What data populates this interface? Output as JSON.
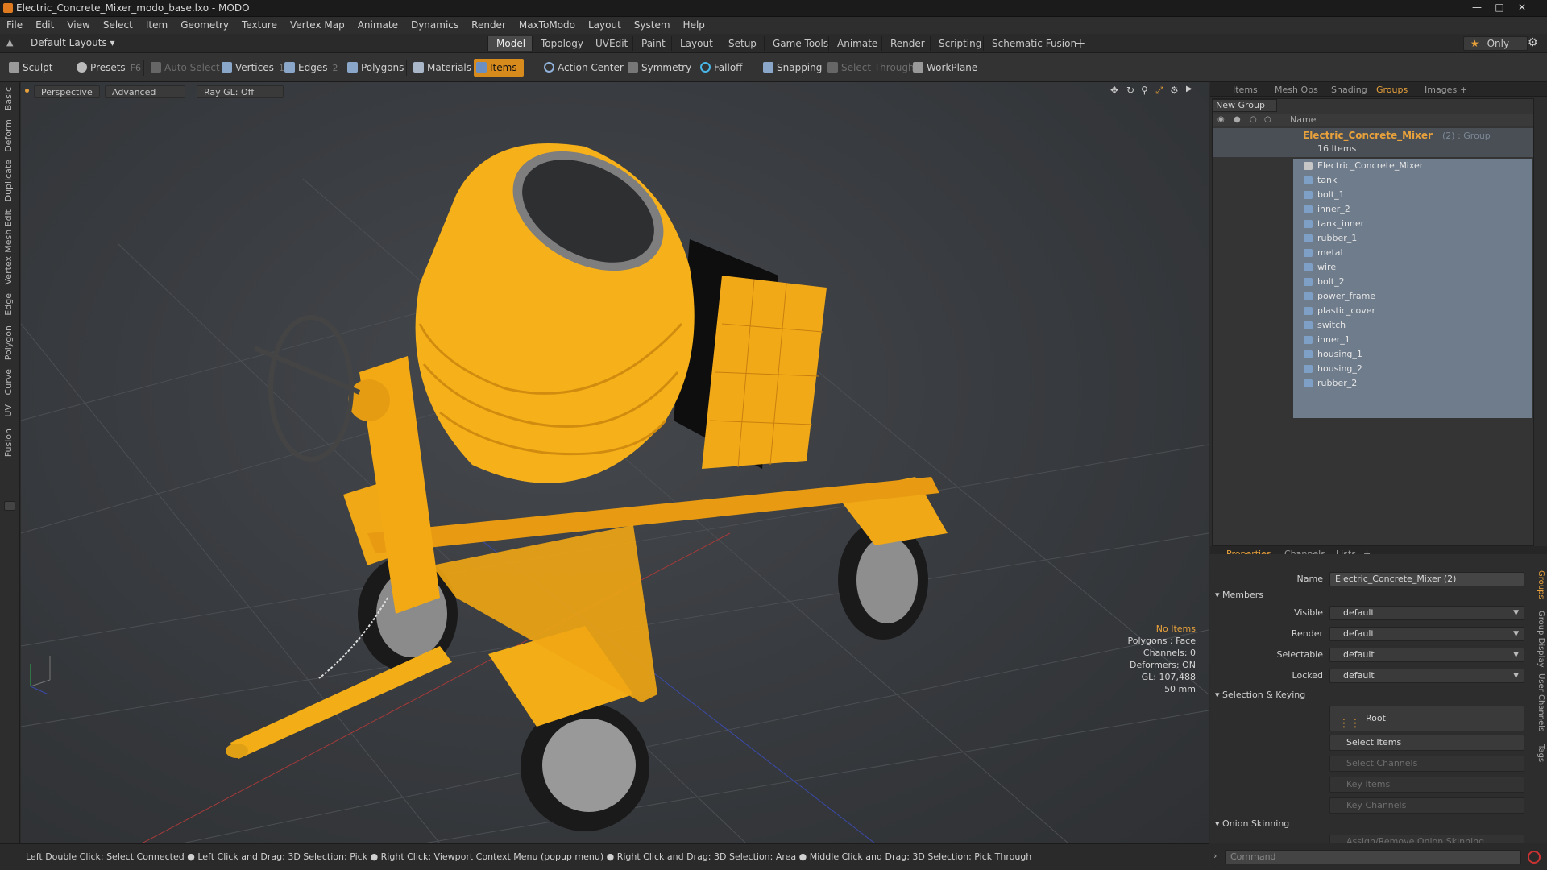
{
  "window": {
    "title": "Electric_Concrete_Mixer_modo_base.lxo - MODO"
  },
  "menu": [
    "File",
    "Edit",
    "View",
    "Select",
    "Item",
    "Geometry",
    "Texture",
    "Vertex Map",
    "Animate",
    "Dynamics",
    "Render",
    "MaxToModo",
    "Layout",
    "System",
    "Help"
  ],
  "layout": {
    "preset": "Default Layouts ▾",
    "tabs": [
      "Model",
      "Topology",
      "UVEdit",
      "Paint",
      "Layout",
      "Setup",
      "Game Tools",
      "Animate",
      "Render",
      "Scripting",
      "Schematic Fusion"
    ],
    "active_tab": "Model",
    "only_label": "Only"
  },
  "toolbar": {
    "sculpt": "Sculpt",
    "presets": "Presets",
    "presets_key": "F6",
    "auto_select": "Auto Select",
    "vertices": "Vertices",
    "vertices_count": "1",
    "edges": "Edges",
    "edges_count": "2",
    "polygons": "Polygons",
    "materials": "Materials",
    "items": "Items",
    "action_center": "Action Center",
    "symmetry": "Symmetry",
    "falloff": "Falloff",
    "snapping": "Snapping",
    "select_through": "Select Through",
    "workplane": "WorkPlane"
  },
  "lefttabs": [
    "Basic",
    "Deform",
    "Duplicate",
    "Mesh Edit",
    "Vertex",
    "Edge",
    "Polygon",
    "Curve",
    "UV",
    "Fusion"
  ],
  "viewport": {
    "perspective": "Perspective",
    "advanced": "Advanced",
    "raygl": "Ray GL: Off",
    "info": {
      "no_items": "No Items",
      "polygons": "Polygons : Face",
      "channels": "Channels: 0",
      "deformers": "Deformers: ON",
      "gl": "GL: 107,488",
      "scale": "50 mm"
    }
  },
  "groups_panel": {
    "tabs": [
      "Items",
      "Mesh Ops",
      "Shading",
      "Groups",
      "Images"
    ],
    "active_tab": "Groups",
    "new_group": "New Group",
    "name_header": "Name",
    "group_name": "Electric_Concrete_Mixer",
    "group_suffix": "(2) : Group",
    "item_count": "16 Items",
    "items": [
      "Electric_Concrete_Mixer",
      "tank",
      "bolt_1",
      "inner_2",
      "tank_inner",
      "rubber_1",
      "metal",
      "wire",
      "bolt_2",
      "power_frame",
      "plastic_cover",
      "switch",
      "inner_1",
      "housing_1",
      "housing_2",
      "rubber_2"
    ]
  },
  "properties": {
    "tabs": [
      "Properties",
      "Channels",
      "Lists"
    ],
    "active_tab": "Properties",
    "name_label": "Name",
    "name_value": "Electric_Concrete_Mixer (2)",
    "members_section": "Members",
    "visible_label": "Visible",
    "visible_value": "default",
    "render_label": "Render",
    "render_value": "default",
    "selectable_label": "Selectable",
    "selectable_value": "default",
    "locked_label": "Locked",
    "locked_value": "default",
    "selection_section": "Selection & Keying",
    "root": "Root",
    "select_items": "Select Items",
    "select_channels": "Select Channels",
    "key_items": "Key Items",
    "key_channels": "Key Channels",
    "onion_section": "Onion Skinning",
    "onion_button": "Assign/Remove Onion Skinning",
    "side_tabs": [
      "Groups",
      "Group Display",
      "User Channels",
      "Tags"
    ]
  },
  "status": {
    "hint": "Left Double Click: Select Connected ● Left Click and Drag: 3D Selection: Pick ● Right Click: Viewport Context Menu (popup menu) ● Right Click and Drag: 3D Selection: Area ● Middle Click and Drag: 3D Selection: Pick Through",
    "command_placeholder": "Command"
  },
  "colors": {
    "accent": "#d88b1d",
    "mixer_yellow": "#f5b21a",
    "selection_blue": "#6f7c8c"
  }
}
